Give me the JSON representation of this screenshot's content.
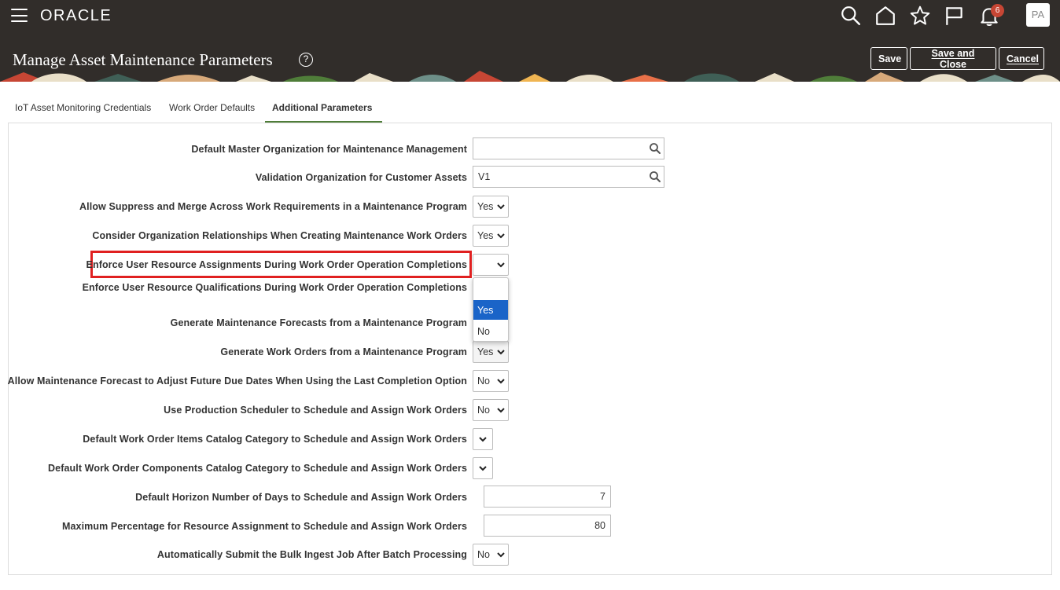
{
  "header": {
    "brand": "ORACLE",
    "notifications_count": "6",
    "avatar_initials": "PA"
  },
  "page": {
    "title": "Manage Asset Maintenance Parameters",
    "help": "?",
    "buttons": {
      "save": "Save",
      "save_and_close": "Save and Close",
      "cancel": "Cancel"
    }
  },
  "tabs": [
    {
      "label": "IoT Asset Monitoring Credentials",
      "active": false
    },
    {
      "label": "Work Order Defaults",
      "active": false
    },
    {
      "label": "Additional Parameters",
      "active": true
    }
  ],
  "fields": [
    {
      "label": "Default Master Organization for Maintenance Management",
      "type": "lov",
      "value": ""
    },
    {
      "label": "Validation Organization for Customer Assets",
      "type": "lov",
      "value": "V1"
    },
    {
      "label": "Allow Suppress and Merge Across Work Requirements in a Maintenance Program",
      "type": "select",
      "value": "Yes"
    },
    {
      "label": "Consider Organization Relationships When Creating Maintenance Work Orders",
      "type": "select",
      "value": "Yes"
    },
    {
      "label": "Enforce User Resource Assignments During Work Order Operation Completions",
      "type": "select",
      "value": ""
    },
    {
      "label": "Enforce User Resource Qualifications During Work Order Operation Completions",
      "type": "select",
      "value": ""
    },
    {
      "label": "Generate Maintenance Forecasts from a Maintenance Program",
      "type": "select",
      "value": ""
    },
    {
      "label": "Generate Work Orders from a Maintenance Program",
      "type": "select",
      "value": "Yes"
    },
    {
      "label": "Allow Maintenance Forecast to Adjust Future Due Dates When Using the Last Completion Option",
      "type": "select",
      "value": "No"
    },
    {
      "label": "Use Production Scheduler to Schedule and Assign Work Orders",
      "type": "select",
      "value": "No"
    },
    {
      "label": "Default Work Order Items Catalog Category to Schedule and Assign Work Orders",
      "type": "select",
      "value": ""
    },
    {
      "label": "Default Work Order Components Catalog Category to Schedule and Assign Work Orders",
      "type": "select",
      "value": ""
    },
    {
      "label": "Default Horizon Number of Days to Schedule and Assign Work Orders",
      "type": "number",
      "value": "7"
    },
    {
      "label": "Maximum Percentage for Resource Assignment to Schedule and Assign Work Orders",
      "type": "number",
      "value": "80"
    },
    {
      "label": "Automatically Submit the Bulk Ingest Job After Batch Processing",
      "type": "select",
      "value": "No"
    }
  ],
  "dropdown": {
    "options": [
      "",
      "Yes",
      "No"
    ],
    "highlighted": "Yes"
  },
  "colors": {
    "header_bg": "#312d2a",
    "active_tab_underline": "#4f7d39",
    "highlight_box": "#e02020",
    "dropdown_selected": "#1a64c8",
    "badge": "#c74634"
  }
}
